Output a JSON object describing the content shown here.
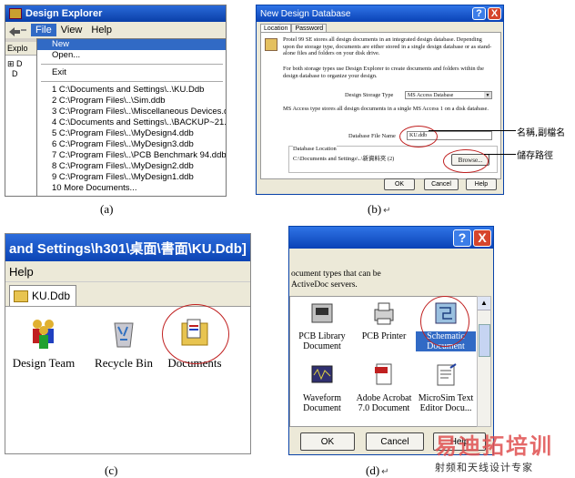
{
  "captions": {
    "a": "(a)",
    "b": "(b)",
    "c": "(c)",
    "d": "(d)",
    "return_mark": "↵"
  },
  "panel_a": {
    "title": "Design Explorer",
    "menus": [
      "File",
      "View",
      "Help"
    ],
    "left_tab": "Explo",
    "tree": [
      "D",
      "D"
    ],
    "file_menu": [
      "New",
      "Open...",
      "Exit",
      "1 C:\\Documents and Settings\\..\\KU.Ddb",
      "2 C:\\Program Files\\..\\Sim.ddb",
      "3 C:\\Program Files\\..\\Miscellaneous Devices.ddb",
      "4 C:\\Documents and Settings\\..\\BACKUP~21.DDB",
      "5 C:\\Program Files\\..\\MyDesign4.ddb",
      "6 C:\\Program Files\\..\\MyDesign3.ddb",
      "7 C:\\Program Files\\..\\PCB Benchmark 94.ddb",
      "8 C:\\Program Files\\..\\MyDesign2.ddb",
      "9 C:\\Program Files\\..\\MyDesign1.ddb",
      "10 More Documents..."
    ]
  },
  "panel_b": {
    "title": "New Design Database",
    "help_btn": "?",
    "close_btn": "X",
    "tabs": [
      "Location",
      "Password"
    ],
    "para1": "Protel 99 SE stores all design documents in an integrated design database. Depending upon the storage type, documents are either stored in a single design database or as stand-alone files and folders on your disk drive.",
    "para2": "For both storage types use Design Explorer to create documents and folders within the design database to organize your design.",
    "storage_label": "Design Storage Type",
    "storage_value": "MS Access Database",
    "storage_desc": "MS Access type stores all design documents in a single MS Access 1 on a disk database.",
    "file_label": "Database File Name",
    "file_value": "KU.ddb",
    "location_label": "Database Location",
    "location_value": "C:\\Documents and Settings\\..\\新資料夾 (2)",
    "browse_btn": "Browse...",
    "ok_btn": "OK",
    "cancel_btn": "Cancel",
    "help_btn2": "Help",
    "annot_name": "名稱,副檔名",
    "annot_path": "儲存路徑"
  },
  "panel_c": {
    "title": "and Settings\\h301\\桌面\\書面\\KU.Ddb]",
    "menu": "Help",
    "tab": "KU.Ddb",
    "icons": [
      "Design Team",
      "Recycle Bin",
      "Documents"
    ]
  },
  "panel_d": {
    "help_btn": "?",
    "close_btn": "X",
    "desc1": "ocument types that can be",
    "desc2": "ActiveDoc servers.",
    "icons": [
      "PCB Library Document",
      "PCB Printer",
      "Schematic Document",
      "Waveform Document",
      "Adobe Acrobat 7.0 Document",
      "MicroSim Text Editor Docu..."
    ],
    "ok_btn": "OK",
    "cancel_btn": "Cancel",
    "help_btn2": "Help"
  },
  "watermark": {
    "line1": "易迪拓培训",
    "line2": "射频和天线设计专家"
  },
  "colors": {
    "titlebar": "#0a42b6",
    "highlight": "#316ac5",
    "annotation": "#c02020"
  }
}
